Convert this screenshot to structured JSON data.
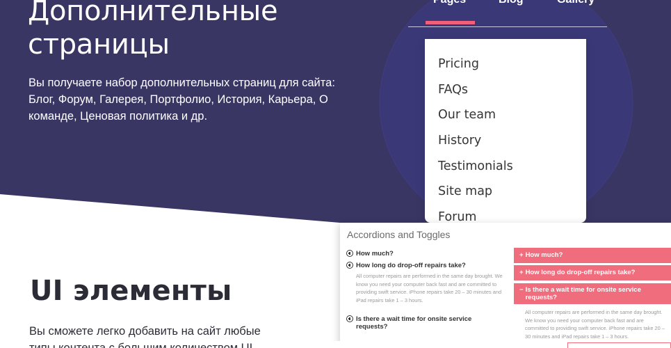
{
  "colors": {
    "hero_bg": "#3a3664",
    "accent": "#f25f7b",
    "toggle_bg": "#f06d7d",
    "text_dark": "#2c2c36"
  },
  "hero": {
    "title": "Дополнительные страницы",
    "description": "Вы получаете набор дополнительных страниц для сайта: Блог, Форум, Галерея, Портфолио, История, Карьера, О команде, Ценовая политика и др."
  },
  "nav": {
    "pages": "Pages",
    "blog": "Blog",
    "gallery": "Gallery"
  },
  "dropdown": {
    "items": [
      "Pricing",
      "FAQs",
      "Our team",
      "History",
      "Testimonials",
      "Site map",
      "Forum"
    ]
  },
  "ui": {
    "title": "UI элементы",
    "description": "Вы сможете легко добавить на сайт любые типы контента с большим количеством UI"
  },
  "accordion": {
    "title": "Accordions and Toggles",
    "questions": [
      "How much?",
      "How long do drop-off repairs take?",
      "Is there a wait time for onsite service requests?"
    ],
    "answer": "All computer repairs are performed in the same day brought. We know you need your computer back fast and are committed to providing swift service. iPhone repairs take 20 – 30 minutes and iPad repairs take 1 – 3 hours."
  },
  "toggles": {
    "items": [
      "How much?",
      "How long do drop-off repairs take?",
      "Is there a wait time for onsite service requests?"
    ],
    "icons": [
      "plus-icon",
      "plus-icon",
      "minus-icon"
    ],
    "answer": "All computer repairs are performed in the same day brought. We know you need your computer back fast and are committed to providing swift service. iPhone repairs take 20 – 30 minutes and iPad repairs take 1 – 3 hours."
  }
}
